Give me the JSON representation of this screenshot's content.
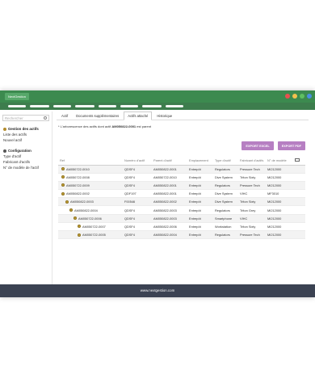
{
  "app": {
    "logo_text": "NextGestion"
  },
  "window_controls": [
    "#e8504f",
    "#f2c14e",
    "#5fbf61",
    "#4a8ee0"
  ],
  "nav_item_count": 8,
  "sidebar": {
    "search_placeholder": "Rechercher",
    "sections": [
      {
        "title": "Gestion des actifs",
        "links": [
          "Liste des actifs",
          "Nouvel actif"
        ]
      },
      {
        "title": "Configuration",
        "links": [
          "Type d'actif",
          "Fabricant d'actifs",
          "N° de modèle de l'actif"
        ]
      }
    ]
  },
  "tabs": [
    "Actif",
    "Documents supplémentaires",
    "Actifs attaché",
    "Historique"
  ],
  "active_tab": 2,
  "notice": {
    "prefix": "* L'arborescence des actifs dont actif ",
    "asset": "AM050822-0001",
    "suffix": " est parent"
  },
  "buttons": {
    "excel": "EXPORT EXCEL",
    "pdf": "EXPORT PDF"
  },
  "table": {
    "headers": [
      "Ref",
      "Numéro d'actif",
      "Parent d'actif",
      "Emplacement",
      "Type d'actif",
      "Fabricant d'actifs",
      "N° de modèle"
    ],
    "rows": [
      {
        "indent": 0,
        "ref": "AM050722-0010",
        "num": "QDSF4",
        "parent": "AM050822-0001",
        "loc": "Entrepôt",
        "type": "Regulators",
        "maker": "Pressure Tech",
        "model": "MI212000"
      },
      {
        "indent": 0,
        "ref": "AM050722-0008",
        "num": "QDSF4",
        "parent": "AM050722-0010",
        "loc": "Entrepôt",
        "type": "Dive System",
        "maker": "Triton Sixty",
        "model": "MI212000"
      },
      {
        "indent": 0,
        "ref": "AM050722-0009",
        "num": "QDSF4",
        "parent": "AM050822-0001",
        "loc": "Entrepôt",
        "type": "Regulators",
        "maker": "Pressure Tech",
        "model": "MI212000"
      },
      {
        "indent": 0,
        "ref": "AM050822-0002",
        "num": "QDF197",
        "parent": "AM050822-0001",
        "loc": "Entrepôt",
        "type": "Dive System",
        "maker": "VIHC",
        "model": "MF3010"
      },
      {
        "indent": 1,
        "ref": "AM050822-0003",
        "num": "F00546",
        "parent": "AM050822-0002",
        "loc": "Entrepôt",
        "type": "Dive System",
        "maker": "Triton Sixty",
        "model": "MI212000"
      },
      {
        "indent": 2,
        "ref": "AM050822-0004",
        "num": "QDSF4",
        "parent": "AM050822-0003",
        "loc": "Entrepôt",
        "type": "Regulators",
        "maker": "Triton Grey",
        "model": "MI212000"
      },
      {
        "indent": 3,
        "ref": "AM050722-0006",
        "num": "QDSF4",
        "parent": "AM050822-0003",
        "loc": "Entrepôt",
        "type": "Smartphone",
        "maker": "VIHC",
        "model": "MI212000"
      },
      {
        "indent": 4,
        "ref": "AM050722-0007",
        "num": "QDSF4",
        "parent": "AM050822-0006",
        "loc": "Entrepôt",
        "type": "Workstation",
        "maker": "Triton Sixty",
        "model": "MI212000"
      },
      {
        "indent": 4,
        "ref": "AM050722-0005",
        "num": "QDSF4",
        "parent": "AM050822-0004",
        "loc": "Entrepôt",
        "type": "Regulators",
        "maker": "Pressure Tech",
        "model": "MI212000"
      }
    ]
  },
  "footer": {
    "text": "www.nextgestion.com"
  }
}
